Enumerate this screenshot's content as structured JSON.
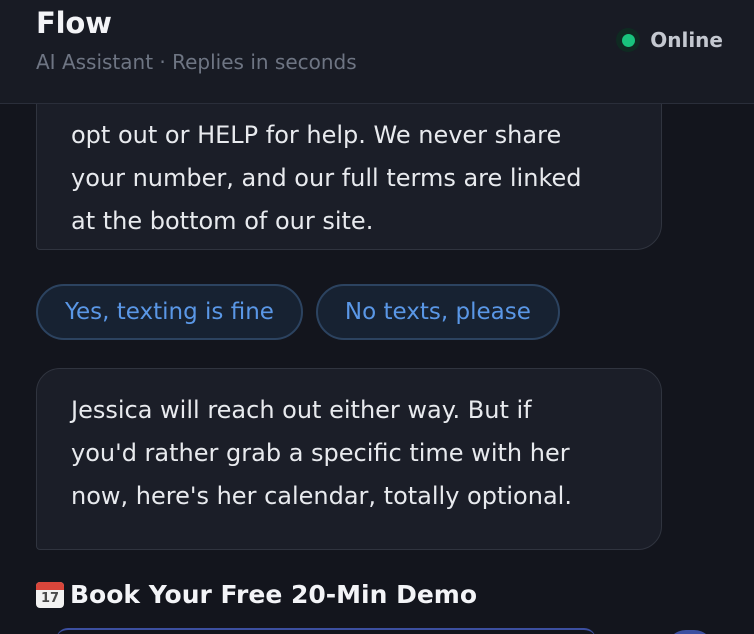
{
  "header": {
    "title": "Flow",
    "subtitle": "AI Assistant · Replies in seconds",
    "status_label": "Online",
    "status_color": "#19c37d"
  },
  "messages": [
    {
      "lines": [
        "opt out or HELP for help. We never share",
        "your number, and our full terms are linked",
        "at the bottom of our site."
      ]
    },
    {
      "lines": [
        "Jessica will reach out either way. But if",
        "you'd rather grab a specific time with her",
        "now, here's her calendar, totally optional."
      ]
    }
  ],
  "quick_replies": [
    "Yes, texting is fine",
    "No texts, please"
  ],
  "demo": {
    "calendar_icon": "calendar-icon",
    "calendar_number": "17",
    "title": "Book Your Free 20-Min Demo"
  },
  "colors": {
    "background": "#13151d",
    "bubble": "#1b1e28",
    "chip_text": "#5a97e6"
  }
}
